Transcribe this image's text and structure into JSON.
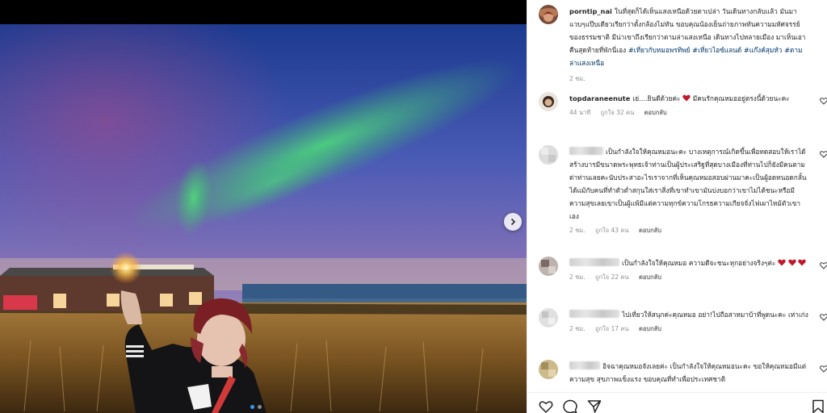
{
  "post": {
    "author": "porntip_nai",
    "caption": "ในที่สุดก็ได้เห็นแสงเหนือด้วยตาเปล่า วันเดินทางกลับแล้ว มันมาแวบๆแป๊บเดียวเรียกว่าตั้งกล้องไม่ทัน ขอบคุณน้องเย็นถ่ายภาพทันความมหัศจรรย์ของธรรมชาติ มีน่าเขาถึงเรียกว่าตามล่าแสงเหนือ เดินทางไปหลายเมือง มาเห็นเอาคืนสุดท้ายที่พักนี่เอง",
    "hashtags": "#เที่ยวกับหมอพรทิพย์ #เที่ยวไอซ์แลนด์ #แก๊งค์สุมหัว #ตามล่าแสงเหนือ",
    "time": "2 ชม."
  },
  "comments": [
    {
      "username": "topdaraneenute",
      "text": "เย่....ยินดีด้วยค่ะ",
      "text_after": "มีคนรักคุณหมออยู่ตรงนี้ด้วยนะคะ",
      "time": "44 นาที",
      "likes": "ถูกใจ 32 คน",
      "reply": "ตอบกลับ"
    },
    {
      "username": "",
      "text": "เป็นกำลังใจให้คุณหมอนะคะ บางเหตุการณ์เกิดขึ้นเพื่อทดสอบให้เราได้สร้างบารมีขนาดพระพุทธเจ้าท่านเป็นผู้ประเสริฐที่สุดบางเมืองที่ท่านไปก็ยังมีคนตามด่าท่านเลยคะนับประสาอะไรเราจากที่เห็นคุณหมอสอบผ่านมาคะเป็นผู้อดทนอดกลั้นได้แม้กับคนที่ทำตัวต่ำสกุนใส่เราสิ่งที่เขาทำเขามันบ่งบอกว่าเขาไม่ได้ชนะหรือมีความสุขเลยเขาเป็นผู้แพ้มีแต่ความทุกข์ความโกรธความเกียจจั่งไฟเผาไหม้ตัวเขาเอง",
      "time": "2 ชม.",
      "likes": "ถูกใจ 43 คน",
      "reply": "ตอบกลับ"
    },
    {
      "username": "",
      "text": "เป็นกำลังใจให้คุณหมอ ความดีจะชนะทุกอย่างจริงๆค่ะ",
      "time": "2 ชม.",
      "likes": "ถูกใจ 22 คน",
      "reply": "ตอบกลับ"
    },
    {
      "username": "",
      "text": "ไปเที่ยวให้สนุกค่ะคุณหมอ อย่า!ไปถือสาหมาบ้าที่พูดนะคะ เห่าเก่ง",
      "time": "2 ชม.",
      "likes": "ถูกใจ 17 คน",
      "reply": "ตอบกลับ"
    },
    {
      "username": "",
      "text": "อิจฉาคุณหมอจังเลยค่ะ เป็นกำลังใจให้คุณหมอนะคะ ขอให้คุณหมอมีแต่ความสุข สุขภาพแข็งแรง ขอบคุณที่ทำเพื่อประเทศชาติ"
    }
  ],
  "icons": {
    "like": "heart-icon",
    "comment": "comment-icon",
    "share": "share-icon",
    "save": "bookmark-icon",
    "next": "chevron-right-icon"
  },
  "colors": {
    "hashtag": "#00376b",
    "meta": "#8e8e8e",
    "heart_red": "#ed4956"
  }
}
